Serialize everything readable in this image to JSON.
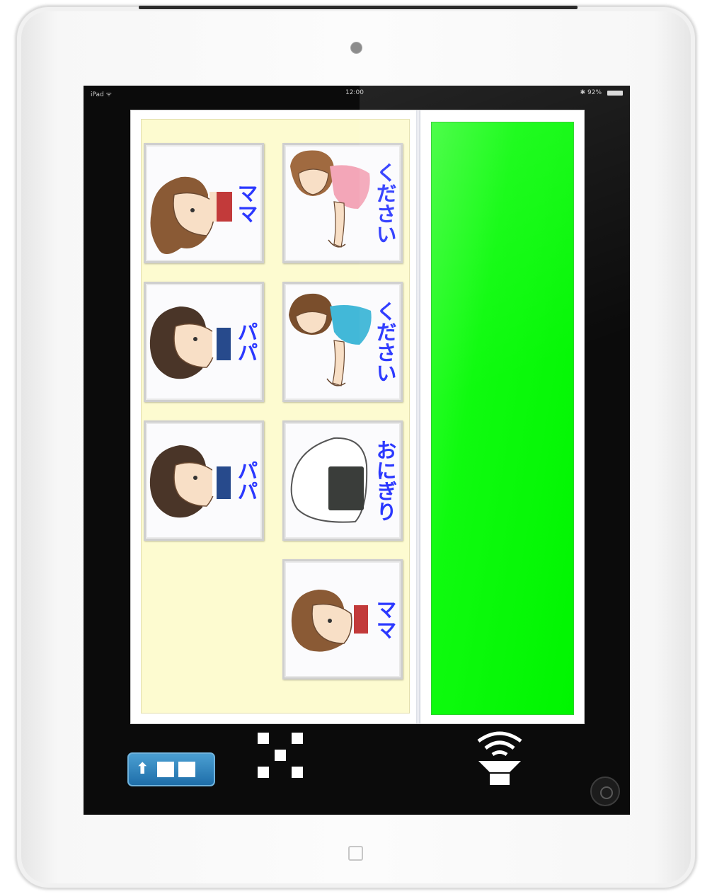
{
  "device": {
    "status_bar": {
      "carrier": "iPad ᯤ",
      "time": "12:00",
      "battery": "✱ 92%"
    }
  },
  "board": {
    "cards": [
      {
        "label": "ママ",
        "icon": "mother-face-icon"
      },
      {
        "label": "ください",
        "icon": "girl-giving-icon"
      },
      {
        "label": "パパ",
        "icon": "father-face-icon"
      },
      {
        "label": "ください",
        "icon": "boy-giving-icon"
      },
      {
        "label": "パパ",
        "icon": "father-face-icon"
      },
      {
        "label": "おにぎり",
        "icon": "onigiri-icon"
      },
      {
        "label": "ママ",
        "icon": "mother-face-icon"
      }
    ]
  },
  "message_area": {
    "color": "#00f500"
  },
  "toolbar": {
    "phrase_button": {
      "icon": "up-arrow-cards-icon"
    },
    "clear_button": {
      "icon": "checker-clear-icon"
    },
    "speak_button": {
      "icon": "speaker-icon"
    }
  }
}
